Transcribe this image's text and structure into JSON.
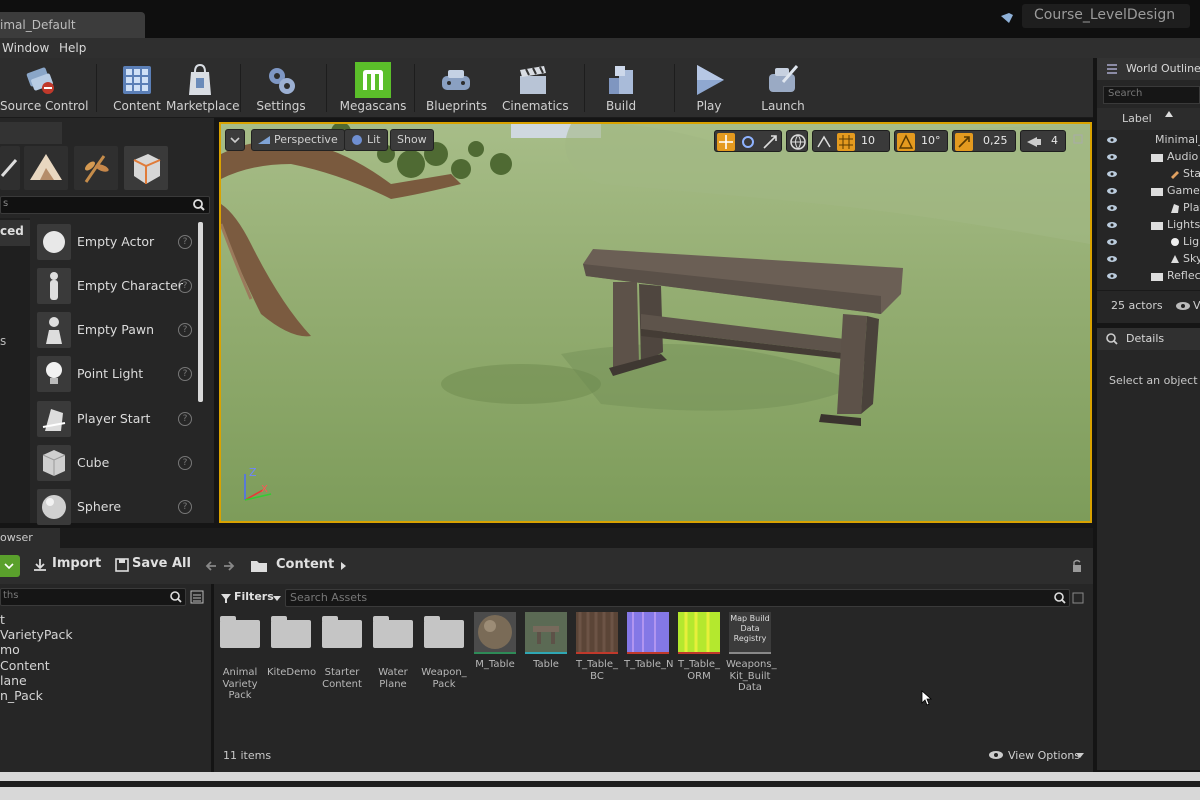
{
  "window": {
    "doc_tab": "imal_Default",
    "project_name": "Course_LevelDesign"
  },
  "menu": [
    "Window",
    "Help"
  ],
  "toolbar": {
    "source_control": "Source Control",
    "content": "Content",
    "marketplace": "Marketplace",
    "settings": "Settings",
    "megascans": "Megascans",
    "blueprints": "Blueprints",
    "cinematics": "Cinematics",
    "build": "Build",
    "play": "Play",
    "launch": "Launch"
  },
  "modes": {
    "category_label": "ced",
    "category_label_2": "s",
    "items": [
      "Empty Actor",
      "Empty Character",
      "Empty Pawn",
      "Point Light",
      "Player Start",
      "Cube",
      "Sphere"
    ]
  },
  "viewport": {
    "perspective": "Perspective",
    "lit": "Lit",
    "show": "Show",
    "grid_snap": "10",
    "rot_snap": "10°",
    "scale_snap": "0,25",
    "cam_speed": "4",
    "axis_z": "Z",
    "axis_x": "X"
  },
  "outliner": {
    "title": "World Outliner",
    "search_placeholder": "Search",
    "label_header": "Label",
    "rows": [
      "Minimal_",
      "Audio",
      "Star",
      "Gamel",
      "Play",
      "Lights",
      "Ligh",
      "Skyl",
      "Reflec"
    ],
    "actors_count": "25 actors",
    "view_label": "V"
  },
  "details": {
    "title": "Details",
    "hint": "Select an object to"
  },
  "content_browser": {
    "tab": "owser",
    "import": "Import",
    "save_all": "Save All",
    "path_root": "Content",
    "filters": "Filters",
    "search_assets": "Search Assets",
    "search_paths": "ths",
    "tree": [
      "t",
      "VarietyPack",
      "mo",
      "Content",
      "lane",
      "n_Pack"
    ],
    "assets": [
      {
        "name": "Animal Variety Pack",
        "kind": "folder"
      },
      {
        "name": "KiteDemo",
        "kind": "folder"
      },
      {
        "name": "Starter Content",
        "kind": "folder"
      },
      {
        "name": "Water Plane",
        "kind": "folder"
      },
      {
        "name": "Weapon_ Pack",
        "kind": "folder"
      },
      {
        "name": "M_Table",
        "kind": "material"
      },
      {
        "name": "Table",
        "kind": "mesh"
      },
      {
        "name": "T_Table_ BC",
        "kind": "texture"
      },
      {
        "name": "T_Table_N",
        "kind": "texture"
      },
      {
        "name": "T_Table_ ORM",
        "kind": "texture"
      },
      {
        "name": "Weapons_ Kit_Built Data",
        "kind": "data",
        "thumb_text": "Map Build Data Registry"
      }
    ],
    "item_count": "11 items",
    "view_options": "View Options"
  },
  "colors": {
    "accent": "#d9a200",
    "megascans": "#5bbf2a",
    "add_new": "#5aa02c"
  }
}
